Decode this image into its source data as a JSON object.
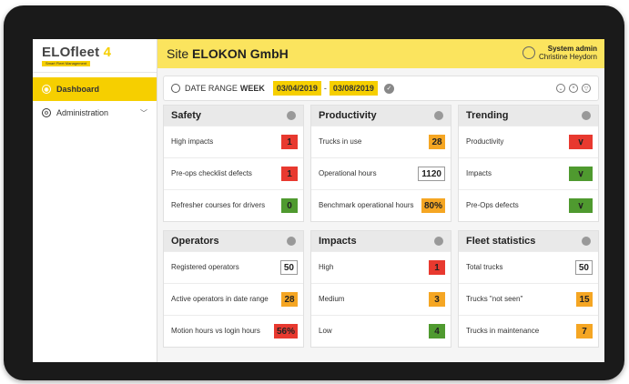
{
  "logo": {
    "brand": "ELOfleet",
    "version": "4",
    "tagline": "Smart Fleet Management"
  },
  "sidebar": {
    "items": [
      {
        "label": "Dashboard",
        "icon": "dashboard-icon"
      },
      {
        "label": "Administration",
        "icon": "gear-icon"
      }
    ]
  },
  "header": {
    "site_prefix": "Site",
    "site_name": "ELOKON GmbH",
    "user_role": "System admin",
    "user_name": "Christine Heydorn"
  },
  "daterange": {
    "label": "DATE RANGE",
    "period": "WEEK",
    "start": "03/04/2019",
    "separator": "-",
    "end": "03/08/2019"
  },
  "cards": {
    "safety": {
      "title": "Safety",
      "rows": [
        {
          "label": "High impacts",
          "value": "1",
          "color": "red"
        },
        {
          "label": "Pre-ops checklist defects",
          "value": "1",
          "color": "red"
        },
        {
          "label": "Refresher courses for drivers",
          "value": "0",
          "color": "green"
        }
      ]
    },
    "productivity": {
      "title": "Productivity",
      "rows": [
        {
          "label": "Trucks in use",
          "value": "28",
          "color": "orange"
        },
        {
          "label": "Operational hours",
          "value": "1120",
          "color": "white"
        },
        {
          "label": "Benchmark operational hours",
          "value": "80%",
          "color": "orange"
        }
      ]
    },
    "trending": {
      "title": "Trending",
      "rows": [
        {
          "label": "Productivity",
          "direction": "down",
          "color": "red"
        },
        {
          "label": "Impacts",
          "direction": "down",
          "color": "green"
        },
        {
          "label": "Pre-Ops defects",
          "direction": "down",
          "color": "green"
        }
      ]
    },
    "operators": {
      "title": "Operators",
      "rows": [
        {
          "label": "Registered operators",
          "value": "50",
          "color": "white"
        },
        {
          "label": "Active operators in date range",
          "value": "28",
          "color": "orange"
        },
        {
          "label": "Motion hours vs login hours",
          "value": "56%",
          "color": "red"
        }
      ]
    },
    "impacts": {
      "title": "Impacts",
      "rows": [
        {
          "label": "High",
          "value": "1",
          "color": "red"
        },
        {
          "label": "Medium",
          "value": "3",
          "color": "orange"
        },
        {
          "label": "Low",
          "value": "4",
          "color": "green"
        }
      ]
    },
    "fleet": {
      "title": "Fleet statistics",
      "rows": [
        {
          "label": "Total trucks",
          "value": "50",
          "color": "white"
        },
        {
          "label": "Trucks \"not seen\"",
          "value": "15",
          "color": "orange"
        },
        {
          "label": "Trucks in maintenance",
          "value": "7",
          "color": "orange"
        }
      ]
    }
  }
}
